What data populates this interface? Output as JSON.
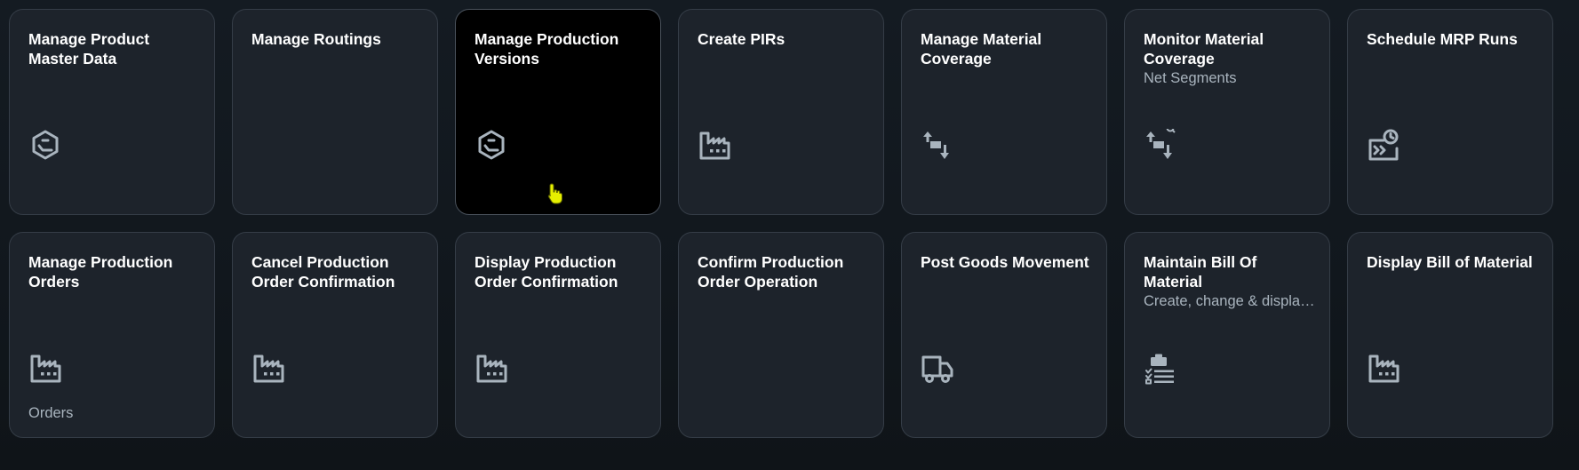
{
  "tiles": [
    {
      "title": "Manage Product Master Data",
      "subtitle": "",
      "footer": "",
      "icon": "product-hexagon-icon"
    },
    {
      "title": "Manage Routings",
      "subtitle": "",
      "footer": "",
      "icon": ""
    },
    {
      "title": "Manage Production Versions",
      "subtitle": "",
      "footer": "",
      "icon": "product-hexagon-icon"
    },
    {
      "title": "Create PIRs",
      "subtitle": "",
      "footer": "",
      "icon": "factory-icon"
    },
    {
      "title": "Manage Material Coverage",
      "subtitle": "",
      "footer": "",
      "icon": "material-flow-icon"
    },
    {
      "title": "Monitor Material Coverage",
      "subtitle": "Net Segments",
      "footer": "",
      "icon": "material-flow-search-icon"
    },
    {
      "title": "Schedule MRP Runs",
      "subtitle": "",
      "footer": "",
      "icon": "schedule-run-icon"
    },
    {
      "title": "Manage Production Orders",
      "subtitle": "",
      "footer": "Orders",
      "icon": "factory-icon"
    },
    {
      "title": "Cancel Production Order Confirmation",
      "subtitle": "",
      "footer": "",
      "icon": "factory-icon"
    },
    {
      "title": "Display Production Order Confirmation",
      "subtitle": "",
      "footer": "",
      "icon": "factory-icon"
    },
    {
      "title": "Confirm Production Order Operation",
      "subtitle": "",
      "footer": "",
      "icon": ""
    },
    {
      "title": "Post Goods Movement",
      "subtitle": "",
      "footer": "",
      "icon": "truck-icon"
    },
    {
      "title": "Maintain Bill Of Material",
      "subtitle": "Create, change & display BOMs",
      "footer": "",
      "icon": "bom-checklist-icon"
    },
    {
      "title": "Display Bill of Material",
      "subtitle": "",
      "footer": "",
      "icon": "factory-icon"
    }
  ],
  "colors": {
    "background": "#12181e",
    "tile_background": "#1d232b",
    "tile_border": "#353d47",
    "active_tile_background": "#000000",
    "title": "#ffffff",
    "subtitle": "#a9b4be",
    "icon": "#a9b4be",
    "cursor": "#e6f000"
  }
}
